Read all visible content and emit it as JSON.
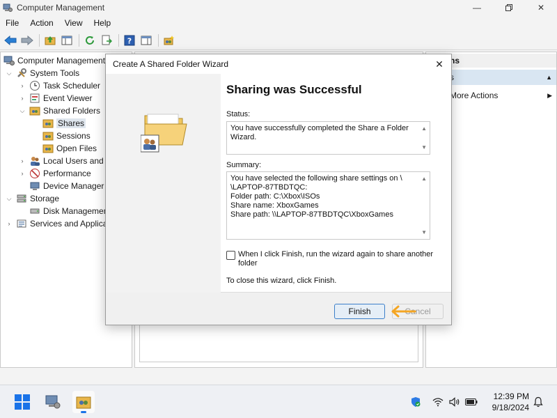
{
  "window": {
    "title": "Computer Management"
  },
  "menu": [
    "File",
    "Action",
    "View",
    "Help"
  ],
  "tree": {
    "items": [
      {
        "label": "Computer Management",
        "icon": "computer-management-icon"
      },
      {
        "label": "System Tools",
        "icon": "system-tools-icon"
      },
      {
        "label": "Task Scheduler",
        "icon": "clock-icon"
      },
      {
        "label": "Event Viewer",
        "icon": "event-viewer-icon"
      },
      {
        "label": "Shared Folders",
        "icon": "shared-folders-icon"
      },
      {
        "label": "Shares",
        "icon": "shares-icon"
      },
      {
        "label": "Sessions",
        "icon": "sessions-icon"
      },
      {
        "label": "Open Files",
        "icon": "open-files-icon"
      },
      {
        "label": "Local Users and G",
        "icon": "users-icon"
      },
      {
        "label": "Performance",
        "icon": "performance-icon"
      },
      {
        "label": "Device Manager",
        "icon": "device-manager-icon"
      },
      {
        "label": "Storage",
        "icon": "storage-icon"
      },
      {
        "label": "Disk Managemen",
        "icon": "disk-management-icon"
      },
      {
        "label": "Services and Applica",
        "icon": "services-icon"
      }
    ]
  },
  "actions": {
    "header": "ns",
    "sub": "s",
    "more": "More Actions"
  },
  "dialog": {
    "title": "Create A Shared Folder Wizard",
    "heading": "Sharing was Successful",
    "status_label": "Status:",
    "status_text": "You have successfully completed the Share a Folder Wizard.",
    "summary_label": "Summary:",
    "summary_lines": [
      "You have selected the following share settings on \\",
      "\\LAPTOP-87TBDTQC:",
      "Folder path: C:\\Xbox\\ISOs",
      "Share name: XboxGames",
      "Share path: \\\\LAPTOP-87TBDTQC\\XboxGames"
    ],
    "checkbox_label": "When I click Finish, run the wizard again to share another folder",
    "checkbox_checked": false,
    "close_hint": "To close this wizard, click Finish.",
    "finish_label": "Finish",
    "cancel_label": "Cancel"
  },
  "taskbar": {
    "time": "12:39 PM",
    "date": "9/18/2024"
  },
  "colors": {
    "accent": "#3c7fc9",
    "arrow": "#f5a623",
    "selection": "#dfe6ee"
  }
}
